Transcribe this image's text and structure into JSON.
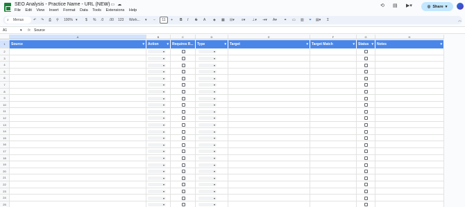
{
  "doc": {
    "title": "SEO Analysis - Practice Name - URL (NEW)",
    "menus": [
      "File",
      "Edit",
      "View",
      "Insert",
      "Format",
      "Data",
      "Tools",
      "Extensions",
      "Help"
    ],
    "share_label": "Share"
  },
  "toolbar": {
    "menus_label": "Menus",
    "zoom": "100%",
    "currency": "$",
    "percent": "%",
    "decimal_less": ".0",
    "decimal_more": ".00",
    "number_format": "123",
    "font": "Work...",
    "font_size": "11"
  },
  "formula_bar": {
    "cell_ref": "A1",
    "fx": "fx",
    "value": "Source"
  },
  "columns": [
    "A",
    "B",
    "C",
    "D",
    "E",
    "F",
    "G",
    "H"
  ],
  "headers": [
    "Source",
    "Action",
    "Requires R...",
    "Type",
    "Target",
    "Target Match",
    "Status",
    "Notes"
  ],
  "rows": [
    "1",
    "2",
    "3",
    "4",
    "5",
    "6",
    "7",
    "8",
    "9",
    "10",
    "11",
    "12",
    "13",
    "14",
    "15",
    "16",
    "17",
    "18",
    "19",
    "20",
    "21",
    "22",
    "23",
    "24",
    "25"
  ],
  "colors": {
    "header_fill": "#4a86e8",
    "sheets_green": "#188038",
    "share_bg": "#c2e7ff"
  }
}
